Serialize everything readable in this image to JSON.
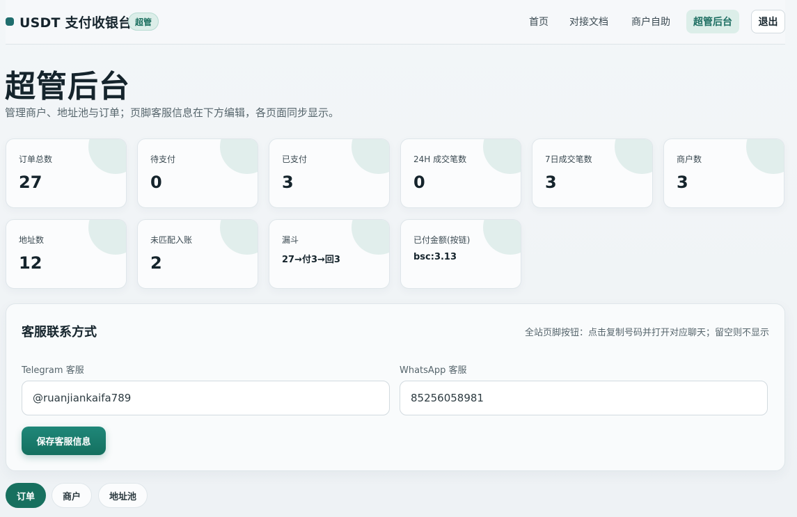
{
  "header": {
    "brand_title": "USDT 支付收银台",
    "brand_badge": "超管",
    "nav": [
      {
        "label": "首页"
      },
      {
        "label": "对接文档"
      },
      {
        "label": "商户自助"
      },
      {
        "label": "超管后台",
        "active": true
      }
    ],
    "logout_label": "退出"
  },
  "page": {
    "title": "超管后台",
    "subtitle": "管理商户、地址池与订单；页脚客服信息在下方编辑，各页面同步显示。"
  },
  "stats": [
    {
      "label": "订单总数",
      "value": "27"
    },
    {
      "label": "待支付",
      "value": "0"
    },
    {
      "label": "已支付",
      "value": "3"
    },
    {
      "label": "24H 成交笔数",
      "value": "0"
    },
    {
      "label": "7日成交笔数",
      "value": "3"
    },
    {
      "label": "商户数",
      "value": "3"
    },
    {
      "label": "地址数",
      "value": "12"
    },
    {
      "label": "未匹配入账",
      "value": "2"
    },
    {
      "label": "漏斗",
      "value": "27→付3→回3"
    },
    {
      "label": "已付金额(按链)",
      "value": "bsc:3.13"
    }
  ],
  "support": {
    "title": "客服联系方式",
    "note": "全站页脚按钮：点击复制号码并打开对应聊天；留空则不显示",
    "telegram_label": "Telegram 客服",
    "telegram_value": "@ruanjiankaifa789",
    "whatsapp_label": "WhatsApp 客服",
    "whatsapp_value": "85256058981",
    "save_label": "保存客服信息"
  },
  "tabs": [
    {
      "label": "订单",
      "active": true
    },
    {
      "label": "商户"
    },
    {
      "label": "地址池"
    }
  ],
  "colors": {
    "accent": "#17705f",
    "accent_light": "#dceee9",
    "text": "#15242c",
    "muted": "#56656c"
  }
}
